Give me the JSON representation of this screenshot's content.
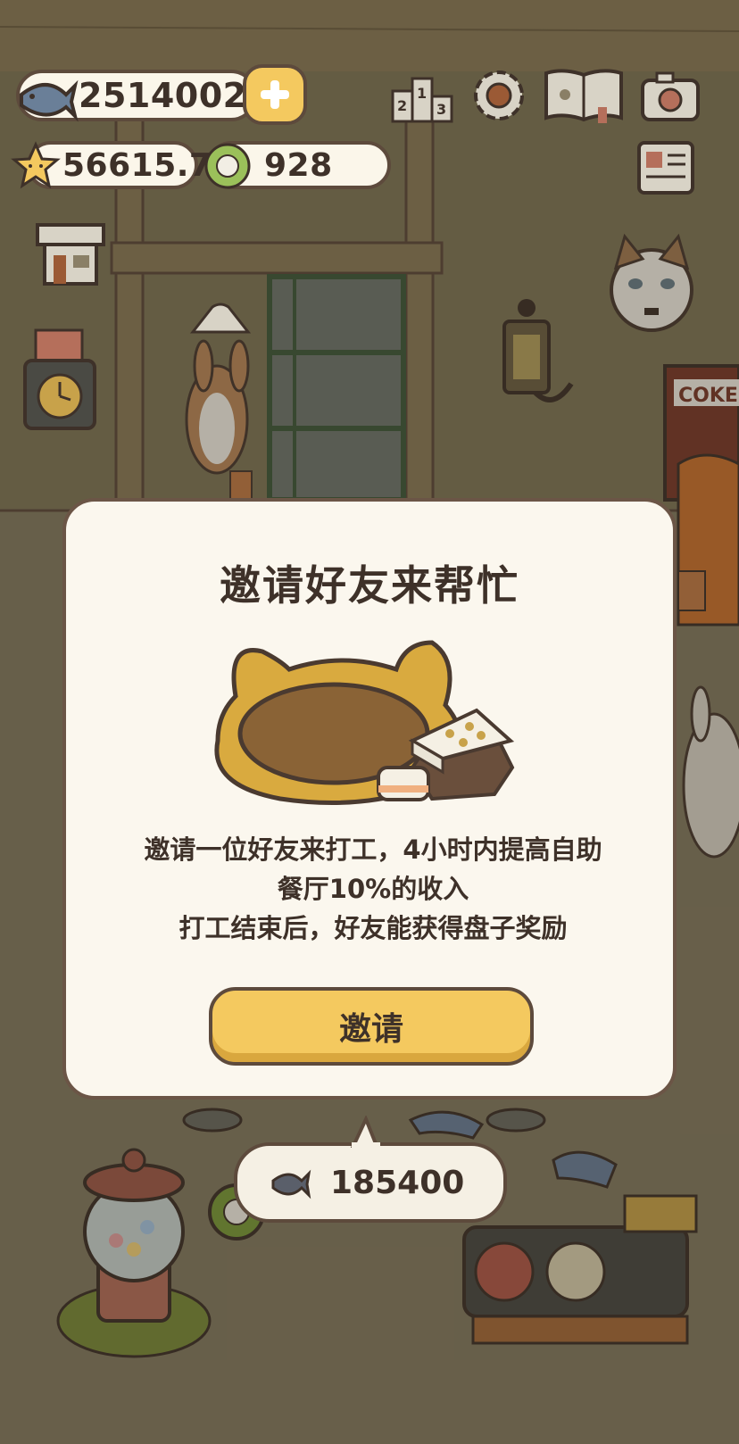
{
  "hud": {
    "fish_amount": "2514002",
    "star_amount": "56615.7",
    "plate_amount": "928"
  },
  "icons": {
    "fish": "fish-icon",
    "add": "plus-icon",
    "star": "star-icon",
    "plate": "plate-icon",
    "ranking": "podium-icon",
    "settings": "gear-icon",
    "book": "paw-book-icon",
    "camera": "camera-icon",
    "news": "newspaper-icon",
    "shop": "shop-icon",
    "clock": "time-clock-icon",
    "cloud": "cloud-icon"
  },
  "modal": {
    "title": "邀请好友来帮忙",
    "desc_line1": "邀请一位好友来打工，4小时内提高自助",
    "desc_line2": "餐厅10%的收入",
    "desc_line3": "打工结束后，好友能获得盘子奖励",
    "button_label": "邀请"
  },
  "counter_bubble": {
    "value": "185400"
  },
  "scene_text": {
    "sign": "COKE"
  },
  "colors": {
    "accent": "#f4c95f",
    "outline": "#5d4a3c",
    "panel": "#fbf7ee"
  }
}
